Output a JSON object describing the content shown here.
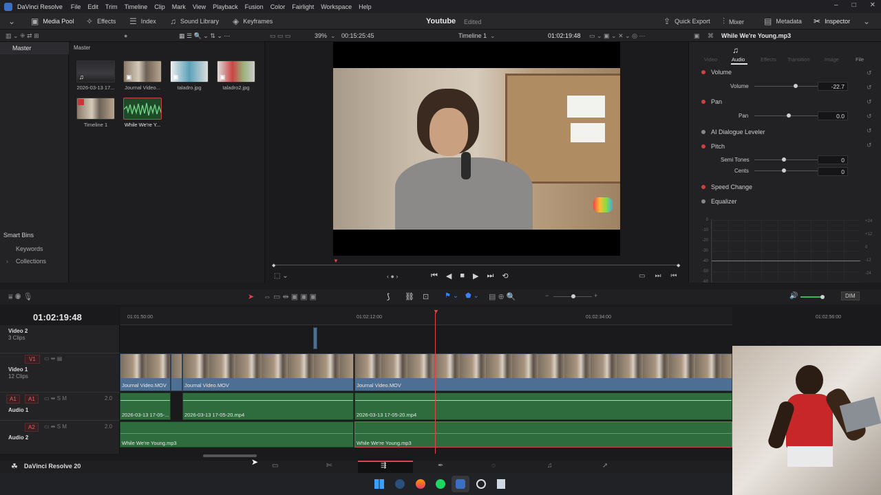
{
  "app": {
    "title": "DaVinci Resolve",
    "footer_brand": "DaVinci Resolve 20"
  },
  "menu": [
    "File",
    "Edit",
    "Trim",
    "Timeline",
    "Clip",
    "Mark",
    "View",
    "Playback",
    "Fusion",
    "Color",
    "Fairlight",
    "Workspace",
    "Help"
  ],
  "toolbar": {
    "media_pool": "Media Pool",
    "effects": "Effects",
    "index": "Index",
    "sound_library": "Sound Library",
    "keyframes": "Keyframes",
    "project_name": "Youtube",
    "project_status": "Edited",
    "quick_export": "Quick Export",
    "mixer": "Mixer",
    "metadata": "Metadata",
    "inspector": "Inspector"
  },
  "viewer_bar": {
    "zoom": "39%",
    "duration": "00:15:25:45",
    "timeline_name": "Timeline 1",
    "timecode": "01:02:19:48",
    "inspector_clip": "While We're Young.mp3"
  },
  "bins": {
    "master": "Master",
    "master_header": "Master",
    "smart_bins": "Smart Bins",
    "keywords": "Keywords",
    "collections": "Collections"
  },
  "pool_items": [
    {
      "label": "2026-03-13 17..."
    },
    {
      "label": "Journal Video..."
    },
    {
      "label": "taladro.jpg"
    },
    {
      "label": "taladro2.jpg"
    },
    {
      "label": "Timeline 1"
    },
    {
      "label": "While We're Y..."
    }
  ],
  "inspector": {
    "tabs": [
      "Video",
      "Audio",
      "Effects",
      "Transition",
      "Image",
      "File"
    ],
    "volume": {
      "title": "Volume",
      "label": "Volume",
      "value": "-22.7",
      "level": 0.6
    },
    "pan": {
      "title": "Pan",
      "label": "Pan",
      "value": "0.0",
      "level": 0.5
    },
    "ai_dialogue": "AI Dialogue Leveler",
    "pitch": {
      "title": "Pitch",
      "semi_label": "Semi Tones",
      "semi_value": "0",
      "cents_label": "Cents",
      "cents_value": "0"
    },
    "speed_change": "Speed Change",
    "equalizer": "Equalizer",
    "eq_left_ticks": [
      "0",
      "-10",
      "-20",
      "-30",
      "-40",
      "-50",
      "-60"
    ],
    "eq_right_ticks": [
      "+24",
      "+12",
      "0",
      "-12",
      "-24"
    ]
  },
  "timeline": {
    "timecode": "01:02:19:48",
    "ruler": [
      "01:01:50:00",
      "01:02:12:00",
      "01:02:34:00",
      "01:02:56:00"
    ],
    "dim": "DIM",
    "tracks": {
      "v2": {
        "name": "Video 2",
        "clips": "3 Clips"
      },
      "v1": {
        "tag": "V1",
        "name": "Video 1",
        "clips": "12 Clips"
      },
      "a1": {
        "tag_src": "A1",
        "tag": "A1",
        "name": "Audio 1",
        "chan": "2.0"
      },
      "a2": {
        "tag": "A2",
        "name": "Audio 2",
        "chan": "2.0"
      }
    },
    "v1_clips": [
      "Journal Video.MOV",
      "Journal Video.MOV",
      "Journal Video.MOV"
    ],
    "a1_clips": [
      "2026-03-13 17-05-...",
      "2026-03-13 17-05-20.mp4",
      "2026-03-13 17-05-20.mp4"
    ],
    "a2_clips": [
      "While We're Young.mp3",
      "While We're Young.mp3"
    ]
  }
}
